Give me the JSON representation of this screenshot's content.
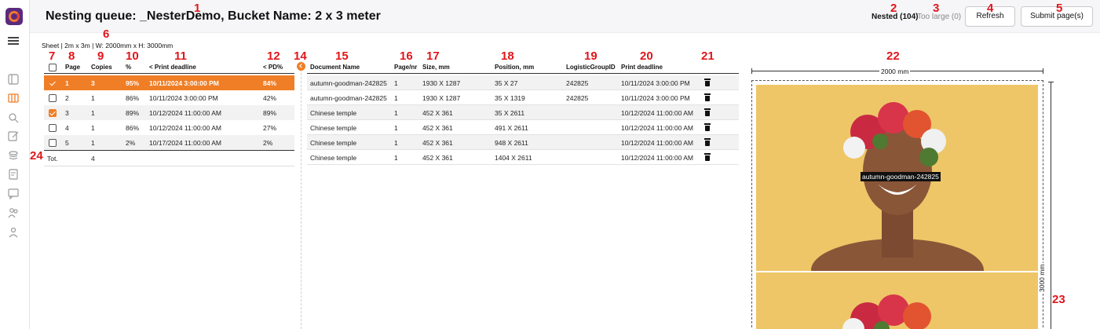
{
  "header": {
    "title": "Nesting queue: _NesterDemo, Bucket Name: 2 x 3 meter",
    "nested_tab": "Nested (104)",
    "too_large_tab": "Too large (0)",
    "refresh_label": "Refresh",
    "submit_label": "Submit page(s)"
  },
  "sheet_info": "Sheet | 2m x 3m | W: 2000mm x H: 3000mm",
  "pages_table": {
    "headers": [
      "Page",
      "Copies",
      "%",
      "< Print deadline",
      "< PD%"
    ],
    "rows": [
      {
        "page": "1",
        "copies": "3",
        "pct": "95%",
        "deadline": "10/11/2024 3:00:00 PM",
        "pd": "84%",
        "checked": true,
        "selected": true
      },
      {
        "page": "2",
        "copies": "1",
        "pct": "86%",
        "deadline": "10/11/2024 3:00:00 PM",
        "pd": "42%",
        "checked": false,
        "selected": false
      },
      {
        "page": "3",
        "copies": "1",
        "pct": "89%",
        "deadline": "10/12/2024 11:00:00 AM",
        "pd": "89%",
        "checked": true,
        "selected": false
      },
      {
        "page": "4",
        "copies": "1",
        "pct": "86%",
        "deadline": "10/12/2024 11:00:00 AM",
        "pd": "27%",
        "checked": false,
        "selected": false
      },
      {
        "page": "5",
        "copies": "1",
        "pct": "2%",
        "deadline": "10/17/2024 11:00:00 AM",
        "pd": "2%",
        "checked": false,
        "selected": false
      }
    ],
    "total_label": "Tot.",
    "total_copies": "4"
  },
  "docs_table": {
    "headers": [
      "Document Name",
      "Page/nr",
      "Size, mm",
      "Position, mm",
      "LogisticGroupID",
      "Print deadline"
    ],
    "rows": [
      {
        "name": "autumn-goodman-242825",
        "page": "1",
        "size": "1930 X 1287",
        "position": "35 X 27",
        "lgid": "242825",
        "deadline": "10/11/2024 3:00:00 PM"
      },
      {
        "name": "autumn-goodman-242825",
        "page": "1",
        "size": "1930 X 1287",
        "position": "35 X 1319",
        "lgid": "242825",
        "deadline": "10/11/2024 3:00:00 PM"
      },
      {
        "name": "Chinese temple",
        "page": "1",
        "size": "452 X 361",
        "position": "35 X 2611",
        "lgid": "",
        "deadline": "10/12/2024 11:00:00 AM"
      },
      {
        "name": "Chinese temple",
        "page": "1",
        "size": "452 X 361",
        "position": "491 X 2611",
        "lgid": "",
        "deadline": "10/12/2024 11:00:00 AM"
      },
      {
        "name": "Chinese temple",
        "page": "1",
        "size": "452 X 361",
        "position": "948 X 2611",
        "lgid": "",
        "deadline": "10/12/2024 11:00:00 AM"
      },
      {
        "name": "Chinese temple",
        "page": "1",
        "size": "452 X 361",
        "position": "1404 X 2611",
        "lgid": "",
        "deadline": "10/12/2024 11:00:00 AM"
      }
    ]
  },
  "preview": {
    "width_label": "2000 mm",
    "height_label": "3000 mm",
    "image_label": "autumn-goodman-242825"
  },
  "markers": [
    "1",
    "2",
    "3",
    "4",
    "5",
    "6",
    "7",
    "8",
    "9",
    "10",
    "11",
    "12",
    "14",
    "15",
    "16",
    "17",
    "18",
    "19",
    "20",
    "21",
    "22",
    "23",
    "24"
  ],
  "colors": {
    "accent": "#f07e26",
    "marker": "#e0161b",
    "image_bg": "#eec667"
  },
  "icons": [
    "app-logo-icon",
    "menu-icon",
    "dashboard-icon",
    "nesting-icon",
    "search-user-icon",
    "edit-icon",
    "layers-icon",
    "document-icon",
    "chat-icon",
    "users-icon",
    "user-settings-icon",
    "trash-icon",
    "chevron-left-icon"
  ]
}
